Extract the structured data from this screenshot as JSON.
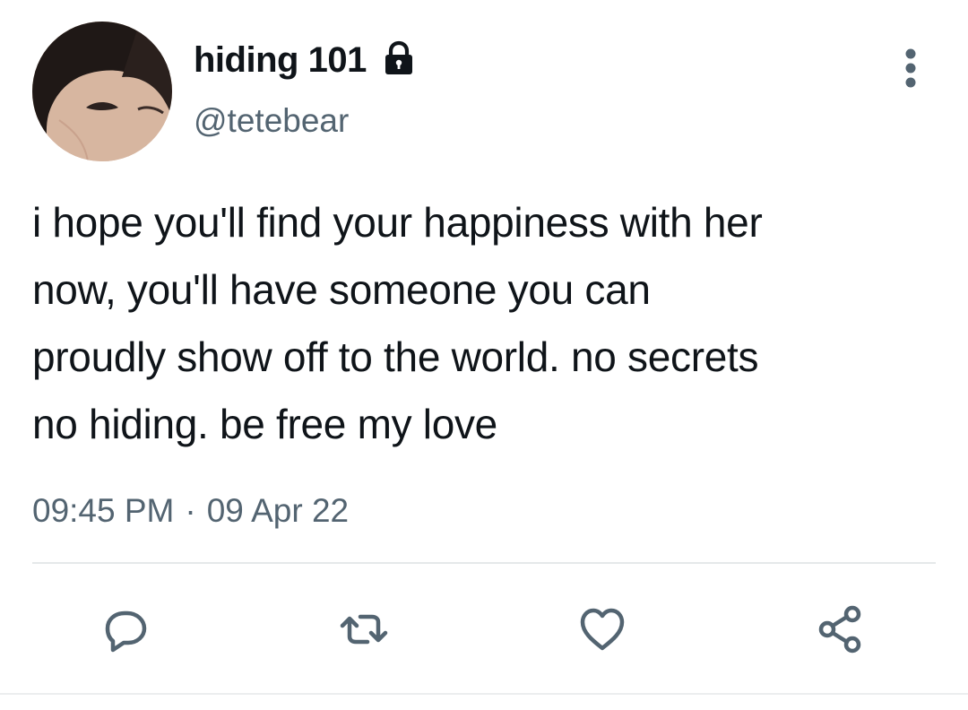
{
  "tweet": {
    "display_name": "hiding 101",
    "handle": "@tetebear",
    "is_protected": true,
    "text_lines": [
      "i hope you'll find your happiness with her",
      "now, you'll have someone you can",
      "proudly show off to the world. no secrets",
      "no hiding. be free my love"
    ],
    "time": "09:45 PM",
    "separator": "·",
    "date": "09 Apr 22"
  },
  "icons": {
    "lock": "lock-icon",
    "more": "more-vertical-icon",
    "reply": "reply-icon",
    "retweet": "retweet-icon",
    "like": "heart-icon",
    "share": "share-icon"
  },
  "colors": {
    "text_primary": "#0f1419",
    "text_secondary": "#536471",
    "icon": "#536471",
    "divider": "#e5e8ea",
    "background": "#ffffff"
  }
}
